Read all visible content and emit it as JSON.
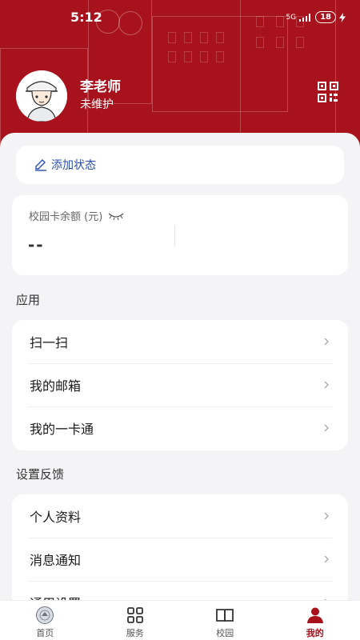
{
  "status_bar": {
    "time": "5:12",
    "network": "5G",
    "battery": "18"
  },
  "profile": {
    "name": "李老师",
    "status": "未维护"
  },
  "status_card": {
    "label": "添加状态"
  },
  "balance": {
    "label": "校园卡余额 (元)",
    "value": "--"
  },
  "sections": {
    "apps": {
      "title": "应用",
      "items": [
        {
          "label": "扫一扫"
        },
        {
          "label": "我的邮箱"
        },
        {
          "label": "我的一卡通"
        }
      ]
    },
    "settings": {
      "title": "设置反馈",
      "items": [
        {
          "label": "个人资料"
        },
        {
          "label": "消息通知"
        },
        {
          "label": "通用设置"
        }
      ]
    }
  },
  "tabbar": {
    "items": [
      {
        "label": "首页",
        "icon": "campus-logo-icon"
      },
      {
        "label": "服务",
        "icon": "grid-icon"
      },
      {
        "label": "校园",
        "icon": "book-icon"
      },
      {
        "label": "我的",
        "icon": "person-icon",
        "active": true
      }
    ]
  },
  "colors": {
    "brand": "#a8121c",
    "link": "#2b4fae",
    "background": "#f4f4f6"
  }
}
